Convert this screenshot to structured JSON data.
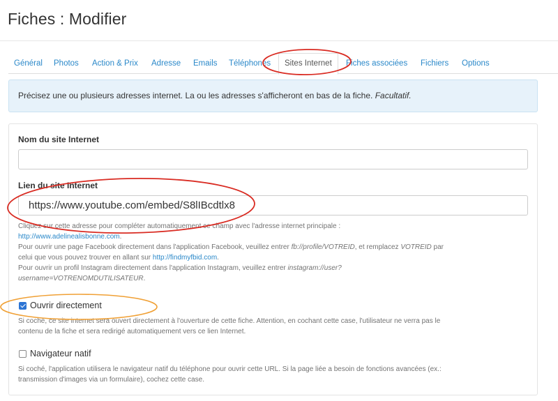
{
  "page": {
    "title": "Fiches : Modifier"
  },
  "tabs": [
    {
      "label": "Général"
    },
    {
      "label": "Photos"
    },
    {
      "label": "Action & Prix"
    },
    {
      "label": "Adresse"
    },
    {
      "label": "Emails"
    },
    {
      "label": "Téléphones"
    },
    {
      "label": "Sites Internet",
      "active": true
    },
    {
      "label": "Fiches associées"
    },
    {
      "label": "Fichiers"
    },
    {
      "label": "Options"
    }
  ],
  "info": {
    "text": "Précisez une ou plusieurs adresses internet. La ou les adresses s'afficheront en bas de la fiche. ",
    "optional": "Facultatif."
  },
  "form": {
    "site_name": {
      "label": "Nom du site Internet",
      "value": ""
    },
    "site_link": {
      "label": "Lien du site Internet",
      "value": "https://www.youtube.com/embed/S8lIBcdtlx8",
      "help_line1": "Cliquez sur cette adresse pour compléter automatiquement ce champ avec l'adresse internet principale :",
      "help_link1": "http://www.adelinealisbonne.com",
      "help_fb_1": "Pour ouvrir une page Facebook directement dans l'application Facebook, veuillez entrer ",
      "help_fb_code": "fb://profile/VOTREID",
      "help_fb_2": ", et remplacez ",
      "help_fb_id": "VOTREID",
      "help_fb_3": " par",
      "help_fb_4": "celui que vous pouvez trouver en allant sur ",
      "help_link2": "http://findmyfbid.com",
      "help_ig_1": "Pour ouvrir un profil Instagram directement dans l'application Instagram, veuillez entrer ",
      "help_ig_code1": "instagram://user?",
      "help_ig_code2": "username=VOTRENOMDUTILISATEUR"
    },
    "open_direct": {
      "label": "Ouvrir directement",
      "checked": true,
      "help1": "Si coché, ce site internet sera ouvert directement à l'ouverture de cette fiche. Attention, en cochant cette case, l'utilisateur ne verra pas le",
      "help2": "contenu de la fiche et sera redirigé automatiquement vers ce lien Internet."
    },
    "native_browser": {
      "label": "Navigateur natif",
      "checked": false,
      "help1": "Si coché, l'application utilisera le navigateur natif du téléphone pour ouvrir cette URL. Si la page liée a besoin de fonctions avancées (ex.:",
      "help2": "transmission d'images via un formulaire), cochez cette case."
    }
  },
  "colors": {
    "link": "#2a88c9",
    "annotation_red": "#d92b22",
    "annotation_orange": "#f0a035",
    "info_bg": "#e7f2fa"
  }
}
